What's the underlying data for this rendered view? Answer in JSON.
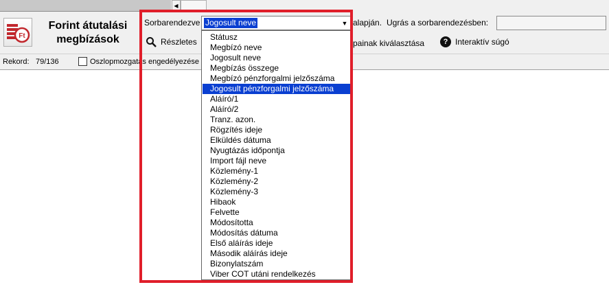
{
  "window": {
    "title": "Forint átutalási megbízások"
  },
  "toolbar": {
    "sort_label": "Sorbarendezve",
    "sort_selected": "Jogosult neve",
    "sort_suffix": "alapján.",
    "jump_label": "Ugrás a sorbarendezésben:",
    "jump_value": "",
    "details_label": "Részletes",
    "columns_label_partial": "painak kiválasztása",
    "help_label": "Interaktív súgó"
  },
  "status": {
    "record_label": "Rekord:",
    "record_count": "79/136",
    "column_move_label": "Oszlopmozgatás engedélyezése",
    "column_move_checked": false
  },
  "dropdown": {
    "selected_index": 5,
    "options": [
      "Státusz",
      "Megbízó neve",
      "Jogosult neve",
      "Megbízás összege",
      "Megbízó pénzforgalmi jelzőszáma",
      "Jogosult pénzforgalmi jelzőszáma",
      "Aláíró/1",
      "Aláíró/2",
      "Tranz. azon.",
      "Rögzítés ideje",
      "Elküldés dátuma",
      "Nyugtázás időpontja",
      "Import fájl neve",
      "Közlemény-1",
      "Közlemény-2",
      "Közlemény-3",
      "Hibaok",
      "Felvette",
      "Módosította",
      "Módosítás dátuma",
      "Első aláírás ideje",
      "Második aláírás ideje",
      "Bizonylatszám",
      "Viber COT utáni rendelkezés"
    ]
  },
  "colors": {
    "highlight": "#e01e2a",
    "selection": "#0a3fd1",
    "toolbar_bg": "#f0f0f0"
  },
  "icons": {
    "logo": "forint-coin-stack-icon",
    "details": "search-icon",
    "help": "question-circle-icon",
    "scroll_left": "arrow-left-icon",
    "dropdown": "chevron-down-icon"
  }
}
